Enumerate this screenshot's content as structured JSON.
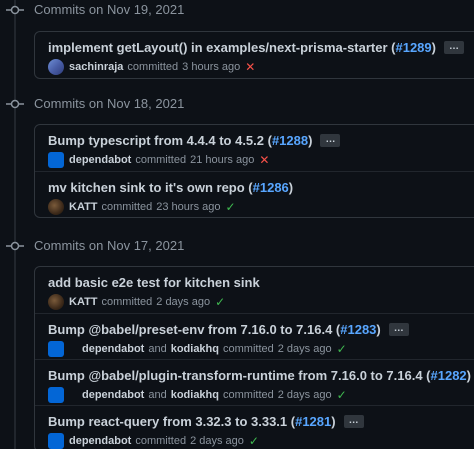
{
  "groups": [
    {
      "date": "Commits on Nov 19, 2021",
      "commits": [
        {
          "title": "implement getLayout() in examples/next-prisma-starter (",
          "pr": "#1289",
          "close": ")",
          "authors": [
            "sachinraja"
          ],
          "and": "",
          "committed": "committed",
          "time": "3 hours ago",
          "status": "fail",
          "status_glyph": "✕"
        }
      ]
    },
    {
      "date": "Commits on Nov 18, 2021",
      "commits": [
        {
          "title": "Bump typescript from 4.4.4 to 4.5.2 (",
          "pr": "#1288",
          "close": ")",
          "authors": [
            "dependabot"
          ],
          "and": "",
          "committed": "committed",
          "time": "21 hours ago",
          "status": "fail",
          "status_glyph": "✕"
        },
        {
          "title": "mv kitchen sink to it's own repo (",
          "pr": "#1286",
          "close": ")",
          "authors": [
            "KATT"
          ],
          "and": "",
          "committed": "committed",
          "time": "23 hours ago",
          "status": "pass",
          "status_glyph": "✓"
        }
      ]
    },
    {
      "date": "Commits on Nov 17, 2021",
      "commits": [
        {
          "title": "add basic e2e test for kitchen sink",
          "pr": "",
          "close": "",
          "authors": [
            "KATT"
          ],
          "and": "",
          "committed": "committed",
          "time": "2 days ago",
          "status": "pass",
          "status_glyph": "✓"
        },
        {
          "title": "Bump @babel/preset-env from 7.16.0 to 7.16.4 (",
          "pr": "#1283",
          "close": ")",
          "authors": [
            "dependabot",
            "kodiakhq"
          ],
          "and": "and",
          "committed": "committed",
          "time": "2 days ago",
          "status": "pass",
          "status_glyph": "✓"
        },
        {
          "title": "Bump @babel/plugin-transform-runtime from 7.16.0 to 7.16.4 (",
          "pr": "#1282",
          "close": ")",
          "authors": [
            "dependabot",
            "kodiakhq"
          ],
          "and": "and",
          "committed": "committed",
          "time": "2 days ago",
          "status": "pass",
          "status_glyph": "✓"
        },
        {
          "title": "Bump react-query from 3.32.3 to 3.33.1 (",
          "pr": "#1281",
          "close": ")",
          "authors": [
            "dependabot"
          ],
          "and": "",
          "committed": "committed",
          "time": "2 days ago",
          "status": "pass",
          "status_glyph": "✓"
        }
      ]
    }
  ],
  "ellipsis_label": "…",
  "colors": {
    "background": "#0d1117",
    "link": "#58a6ff",
    "success": "#3fb950",
    "failure": "#f85149",
    "muted": "#8b949e"
  }
}
